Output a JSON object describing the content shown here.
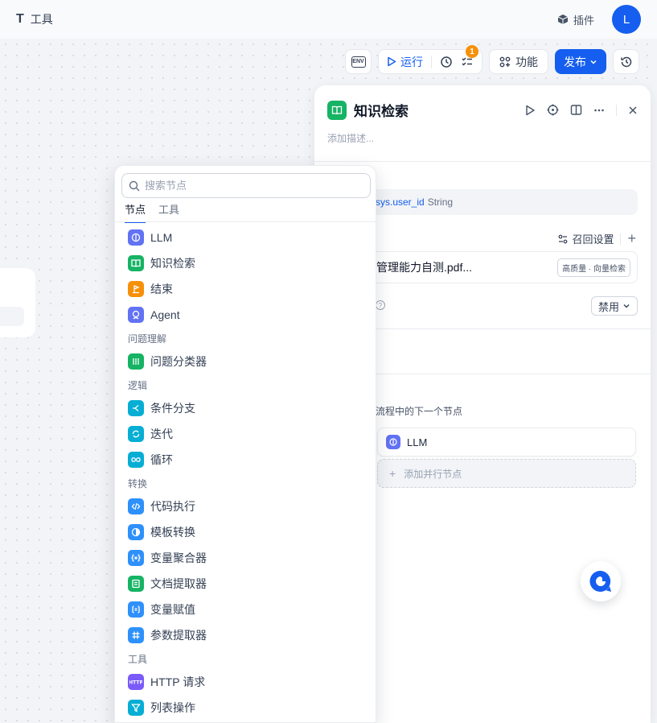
{
  "topbar": {
    "title": "工具",
    "plugin_label": "插件",
    "avatar_letter": "L"
  },
  "toolbar": {
    "env_label": "ENV",
    "run_label": "运行",
    "checklist_count": "1",
    "function_label": "功能",
    "publish_label": "发布"
  },
  "panel": {
    "title": "知识检索",
    "description_placeholder": "添加描述...",
    "query_var_name": "sys.user_id",
    "query_var_type": "String",
    "recall_label": "召回设置",
    "kb_name": "管理能力自测.pdf...",
    "kb_tag": "高质量 · 向量检索",
    "disable_label": "禁用",
    "next_node_label": "流程中的下一个节点",
    "next_node_name": "LLM",
    "add_parallel_label": "添加并行节点"
  },
  "dropdown": {
    "search_placeholder": "搜索节点",
    "tabs": [
      "节点",
      "工具"
    ],
    "items": [
      {
        "label": "LLM",
        "color": "#6172f3"
      },
      {
        "label": "知识检索",
        "color": "#16b364"
      },
      {
        "label": "结束",
        "color": "#f79009"
      },
      {
        "label": "Agent",
        "color": "#6172f3"
      },
      {
        "group": "问题理解"
      },
      {
        "label": "问题分类器",
        "color": "#16b364"
      },
      {
        "group": "逻辑"
      },
      {
        "label": "条件分支",
        "color": "#06aed4"
      },
      {
        "label": "迭代",
        "color": "#06aed4"
      },
      {
        "label": "循环",
        "color": "#06aed4"
      },
      {
        "group": "转换"
      },
      {
        "label": "代码执行",
        "color": "#2e90fa"
      },
      {
        "label": "模板转换",
        "color": "#2e90fa"
      },
      {
        "label": "变量聚合器",
        "color": "#2e90fa"
      },
      {
        "label": "文档提取器",
        "color": "#16b364"
      },
      {
        "label": "变量赋值",
        "color": "#2e90fa"
      },
      {
        "label": "参数提取器",
        "color": "#2e90fa"
      },
      {
        "group": "工具"
      },
      {
        "label": "HTTP 请求",
        "color": "#7a5af8"
      },
      {
        "label": "列表操作",
        "color": "#06aed4"
      }
    ]
  }
}
